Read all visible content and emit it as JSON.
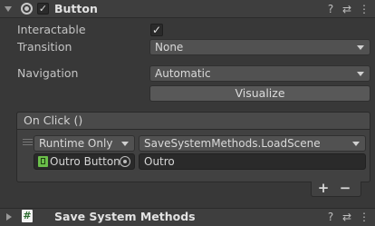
{
  "header": {
    "title": "Button",
    "enabled": true,
    "icons": [
      "help-icon",
      "presets-icon",
      "more-icon"
    ]
  },
  "properties": {
    "interactable_label": "Interactable",
    "interactable_checked": true,
    "transition_label": "Transition",
    "transition_value": "None",
    "navigation_label": "Navigation",
    "navigation_value": "Automatic",
    "visualize_label": "Visualize"
  },
  "on_click": {
    "title": "On Click ()",
    "entries": [
      {
        "call_state": "Runtime Only",
        "function": "SaveSystemMethods.LoadScene",
        "target_object": "Outro Button",
        "argument": "Outro"
      }
    ],
    "add_label": "+",
    "remove_label": "−"
  },
  "next_component": {
    "title": "Save System Methods",
    "script_icon_glyph": "#"
  },
  "glyphs": {
    "check": "✓",
    "help": "?",
    "presets": "⇄",
    "more": "⋮"
  },
  "colors": {
    "background": "#383838",
    "header": "#3e3e3e",
    "field": "#2a2a2a",
    "dropdown": "#515151",
    "object_icon": "#6bbf4a"
  }
}
